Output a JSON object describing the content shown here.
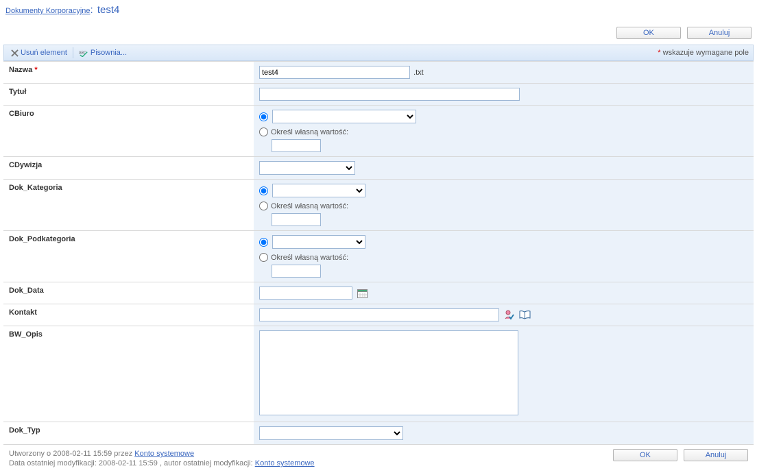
{
  "header": {
    "breadcrumb": "Dokumenty Korporacyjne",
    "title": "test4"
  },
  "buttons": {
    "ok": "OK",
    "cancel": "Anuluj"
  },
  "toolbar": {
    "delete": "Usuń element",
    "spellcheck": "Pisownia...",
    "required_hint": "wskazuje wymagane pole"
  },
  "fields": {
    "nazwa": {
      "label": "Nazwa",
      "value": "test4",
      "ext": ".txt"
    },
    "tytul": {
      "label": "Tytuł",
      "value": ""
    },
    "cbiuro": {
      "label": "CBiuro",
      "own_label": "Określ własną wartość:",
      "own_value": ""
    },
    "cdywizja": {
      "label": "CDywizja"
    },
    "dok_kategoria": {
      "label": "Dok_Kategoria",
      "own_label": "Określ własną wartość:",
      "own_value": ""
    },
    "dok_podkategoria": {
      "label": "Dok_Podkategoria",
      "own_label": "Określ własną wartość:",
      "own_value": ""
    },
    "dok_data": {
      "label": "Dok_Data",
      "value": ""
    },
    "kontakt": {
      "label": "Kontakt",
      "value": ""
    },
    "bw_opis": {
      "label": "BW_Opis",
      "value": ""
    },
    "dok_typ": {
      "label": "Dok_Typ"
    }
  },
  "footer": {
    "created_prefix": "Utworzony o ",
    "created_ts": "2008-02-11 15:59 ",
    "by": " przez ",
    "user": "Konto systemowe",
    "modified_prefix": "Data ostatniej modyfikacji: ",
    "modified_ts": "2008-02-11 15:59 ",
    "mod_author_label": ", autor ostatniej modyfikacji: "
  }
}
